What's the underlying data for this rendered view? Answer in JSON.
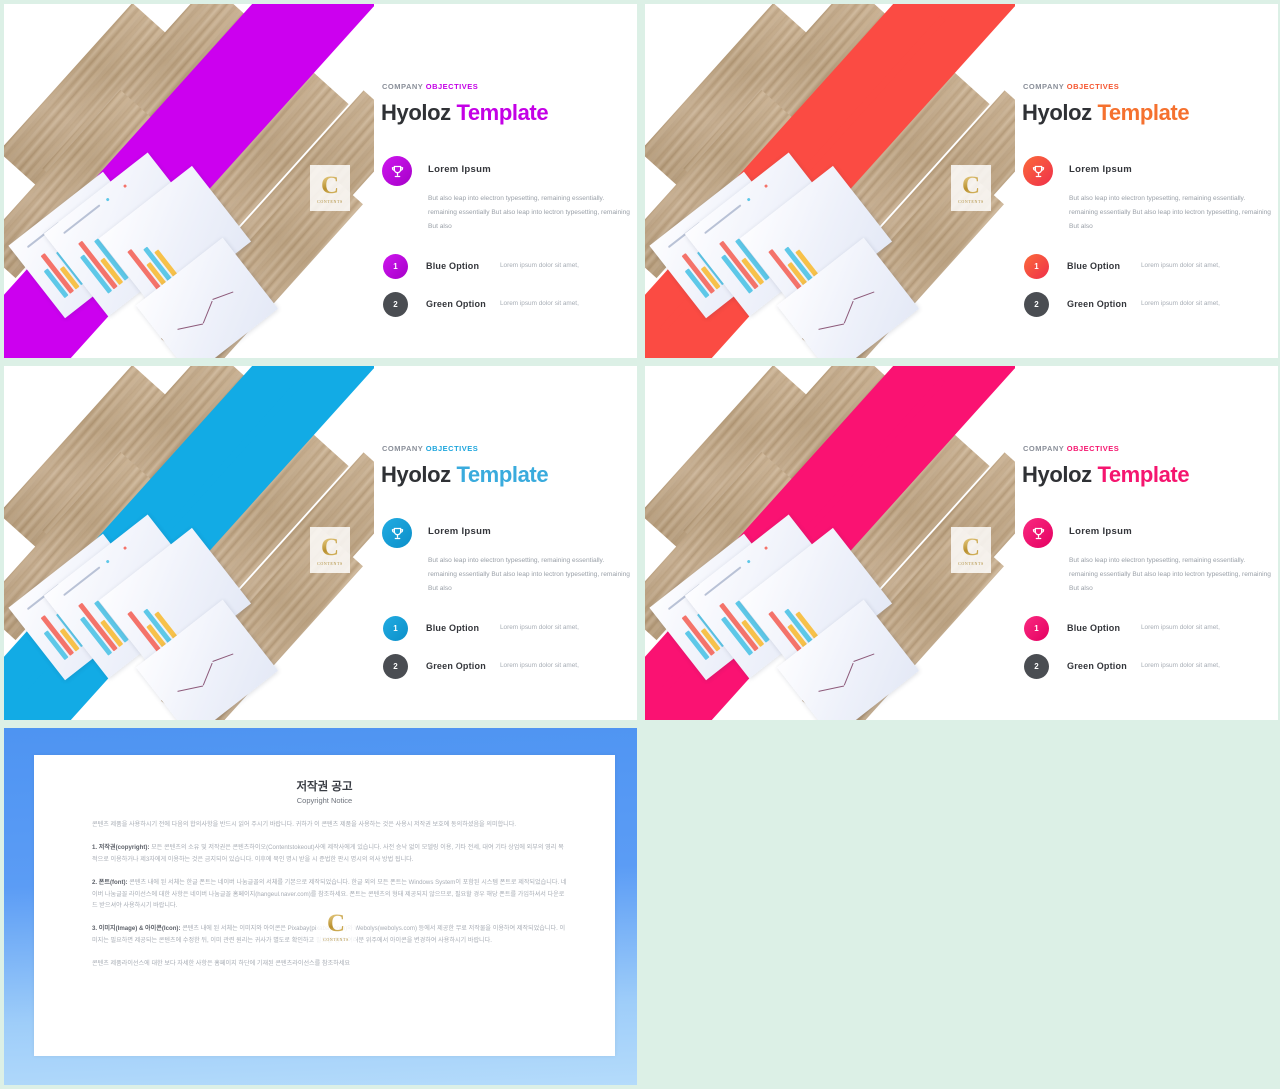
{
  "page": {
    "background_color": "#dcf0e6",
    "slide_background": "#ffffff"
  },
  "common": {
    "eyebrow_prefix": "COMPANY ",
    "eyebrow_accent": "OBJECTIVES",
    "title_main": "Hyoloz ",
    "title_accent": "Template",
    "feature_label": "Lorem Ipsum",
    "feature_body": "But also leap into electron typesetting, remaining essentially. remaining essentially But also leap into lectron typesetting, remaining But also",
    "trophy_icon": "trophy-icon",
    "options": [
      {
        "number": "1",
        "label": "Blue Option",
        "desc": "Lorem ipsum dolor sit amet,"
      },
      {
        "number": "2",
        "label": "Green Option",
        "desc": "Lorem ipsum dolor sit amet,"
      }
    ],
    "option_two_color": "#4a4d52",
    "watermark_letter": "C",
    "watermark_text": "CONTENTS"
  },
  "slides": [
    {
      "name": "magenta",
      "accent": "#c400e6",
      "accent2": "#b800d8",
      "band": "#cc00ef",
      "badge_grad": "linear-gradient(135deg,#cf16ef,#a500c8)"
    },
    {
      "name": "red",
      "accent": "#f5552f",
      "accent2": "#ef3b3b",
      "band": "#fb4b43",
      "badge_grad": "linear-gradient(135deg,#fb6a3a,#ef2f4a)"
    },
    {
      "name": "blue",
      "accent": "#1fa6dd",
      "accent2": "#0d9bd6",
      "band": "#12abe5",
      "badge_grad": "linear-gradient(135deg,#22ace2,#0b8fc9)"
    },
    {
      "name": "pink",
      "accent": "#f5166f",
      "accent2": "#ec0a63",
      "band": "#fa1272",
      "badge_grad": "linear-gradient(135deg,#fa2a80,#e40061)"
    }
  ],
  "copyright": {
    "title": "저작권 공고",
    "subtitle": "Copyright Notice",
    "frame_color_top": "#4e94f2",
    "frame_color_bottom": "#b4dbfb",
    "paragraphs": [
      {
        "heading": "",
        "text": "콘텐츠 제품을 사용하시기 전에 다음의 합의사항을 반드시 읽어 주시기 바랍니다. 귀하가 이 콘텐츠 제품을 사용하는 것은 사용시 저작권 보호에 동의하셨음을 의미합니다."
      },
      {
        "heading": "1. 저작권(copyright): ",
        "text": "모든 콘텐츠의 소유 및 저작권은 콘텐츠하이오(Contentstokeout)사에 제작사에게 있습니다. 사전 승낙 없이 모델링 이용, 기타 전세, 대여 기타 상업에 외부의 영리 목적으로 이용하거나 제3자에게 이용하는 것은 금지되어 있습니다. 이후에 묵인 명시 받을 시 준법한 판시 명시의 의사 방법 됩니다."
      },
      {
        "heading": "2. 폰트(font): ",
        "text": "콘텐츠 내에 된 서체는 한글 폰트는 네이버 나눔글꼴의 서체를 기본으로 제작되었습니다. 한글 외의 모든 폰트는 Windows System이 포함된 시스템 폰트로 제작되었습니다. 네이버 나눔글꼴 라이선스에 대한 사항은 네이버 나눔글꼴 홈페이지(hangeul.naver.com)를 참조하세요. 폰트는 콘텐츠의 형태 제공되지 않으므로, 필요할 경우 해당 폰트를 가입하셔서 다운로드 받으셔야 사용하시기 바랍니다."
      },
      {
        "heading": "3. 이미지(Image) & 아이콘(Icon): ",
        "text": "콘텐츠 내에 된 서체는 이미지와 아이콘은 Pixabay(pixabay.com)와 Webolys(webolys.com) 등에서 제공한 무료 저작물을 이용하여 제작되었습니다. 이미지는 필요하면 제공되는 콘텐츠에 수정한 뒤, 이미 관련 원리는 귀사가 별도로 확인하고 필요할 경우 여러분 위주에서 아이콘을 변경하여 사용하시기 바랍니다."
      },
      {
        "heading": "",
        "text": "콘텐츠 제품라이선스에 대한 보다 자세한 사항은 홈페이지 하단에 기재된 콘텐츠라이선스를 참조하세요"
      }
    ]
  }
}
